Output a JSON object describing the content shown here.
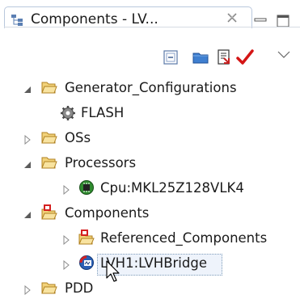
{
  "view": {
    "tab_title": "Components - LV...",
    "tab_icon": "component-tree-icon",
    "close_icon": "close-tab-icon",
    "minimize_icon": "minimize-icon",
    "maximize_icon": "maximize-icon"
  },
  "toolbar": {
    "buttons": [
      {
        "icon": "collapse-all-icon"
      },
      {
        "icon": "folder-icon"
      },
      {
        "icon": "generate-code-icon"
      },
      {
        "icon": "checkmark-icon"
      }
    ],
    "menu_icon": "view-menu-icon"
  },
  "tree": {
    "items": [
      {
        "label": "Generator_Configurations",
        "expanded": true,
        "icon": "folder-open-icon"
      },
      {
        "label": "FLASH",
        "icon": "gear-icon"
      },
      {
        "label": "OSs",
        "expanded": false,
        "icon": "folder-open-icon"
      },
      {
        "label": "Processors",
        "expanded": true,
        "icon": "folder-open-icon"
      },
      {
        "label": "Cpu:MKL25Z128VLK4",
        "expanded": false,
        "icon": "cpu-icon"
      },
      {
        "label": "Components",
        "expanded": true,
        "icon": "components-folder-icon"
      },
      {
        "label": "Referenced_Components",
        "expanded": false,
        "icon": "components-folder-icon"
      },
      {
        "label": "LVH1:LVHBridge",
        "expanded": false,
        "icon": "component-icon",
        "selected": true
      },
      {
        "label": "PDD",
        "expanded": false,
        "icon": "folder-open-icon"
      }
    ]
  },
  "colors": {
    "folder": "#e8b64a",
    "accent_red": "#d42020",
    "selection": "#eef3fb"
  }
}
